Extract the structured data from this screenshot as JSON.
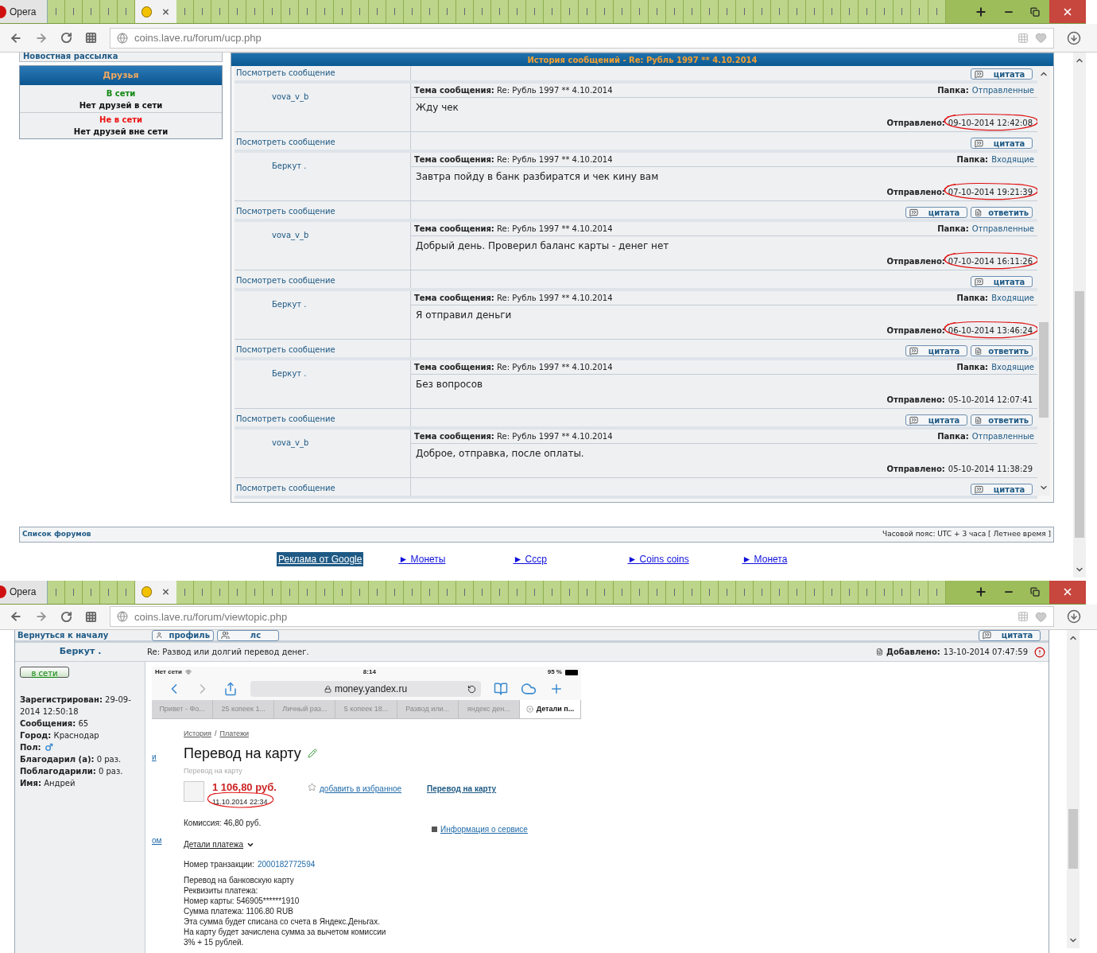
{
  "top_window": {
    "app_label": "Opera",
    "url": "coins.lave.ru/forum/ucp.php",
    "sidebar": {
      "newsletter_link": "Новостная рассылка",
      "friends_title": "Друзья",
      "groups": [
        {
          "heading": "В сети",
          "color": "#118811",
          "note": "Нет друзей в сети"
        },
        {
          "heading": "Не в сети",
          "color": "#ee1111",
          "note": "Нет друзей вне сети"
        }
      ]
    },
    "panel_title": "История сообщений - Re: Рубль 1997 ** 4.10.2014",
    "partial_row": {
      "view_link": "Посмотреть сообщение",
      "buttons": [
        {
          "kind": "quote",
          "label": "цитата"
        }
      ]
    },
    "messages": [
      {
        "author": "vova_v_b",
        "subject_label": "Тема сообщения:",
        "subject": "Re: Рубль 1997 ** 4.10.2014",
        "folder_label": "Папка:",
        "folder": "Отправленные",
        "body": "Жду чек",
        "sent_label": "Отправлено:",
        "sent": "09-10-2014 12:42:08",
        "circled": true,
        "view_link": "Посмотреть сообщение",
        "buttons": [
          {
            "kind": "quote",
            "label": "цитата"
          }
        ]
      },
      {
        "author": "Беркут .",
        "subject_label": "Тема сообщения:",
        "subject": "Re: Рубль 1997 ** 4.10.2014",
        "folder_label": "Папка:",
        "folder": "Входящие",
        "body": "Завтра пойду в банк разбиратся и чек кину вам",
        "sent_label": "Отправлено:",
        "sent": "07-10-2014 19:21:39",
        "circled": true,
        "view_link": "Посмотреть сообщение",
        "buttons": [
          {
            "kind": "quote",
            "label": "цитата"
          },
          {
            "kind": "reply",
            "label": "ответить"
          }
        ]
      },
      {
        "author": "vova_v_b",
        "subject_label": "Тема сообщения:",
        "subject": "Re: Рубль 1997 ** 4.10.2014",
        "folder_label": "Папка:",
        "folder": "Отправленные",
        "body": "Добрый день. Проверил баланс карты - денег нет",
        "sent_label": "Отправлено:",
        "sent": "07-10-2014 16:11:26",
        "circled": true,
        "view_link": "Посмотреть сообщение",
        "buttons": [
          {
            "kind": "quote",
            "label": "цитата"
          }
        ]
      },
      {
        "author": "Беркут .",
        "subject_label": "Тема сообщения:",
        "subject": "Re: Рубль 1997 ** 4.10.2014",
        "folder_label": "Папка:",
        "folder": "Входящие",
        "body": "Я отправил деньги",
        "sent_label": "Отправлено:",
        "sent": "06-10-2014 13:46:24",
        "circled": true,
        "view_link": "Посмотреть сообщение",
        "buttons": [
          {
            "kind": "quote",
            "label": "цитата"
          },
          {
            "kind": "reply",
            "label": "ответить"
          }
        ]
      },
      {
        "author": "Беркут .",
        "subject_label": "Тема сообщения:",
        "subject": "Re: Рубль 1997 ** 4.10.2014",
        "folder_label": "Папка:",
        "folder": "Входящие",
        "body": "Без вопросов",
        "sent_label": "Отправлено:",
        "sent": "05-10-2014 12:07:41",
        "circled": false,
        "view_link": "Посмотреть сообщение",
        "buttons": [
          {
            "kind": "quote",
            "label": "цитата"
          },
          {
            "kind": "reply",
            "label": "ответить"
          }
        ]
      },
      {
        "author": "vova_v_b",
        "subject_label": "Тема сообщения:",
        "subject": "Re: Рубль 1997 ** 4.10.2014",
        "folder_label": "Папка:",
        "folder": "Отправленные",
        "body": "Доброе, отправка, после оплаты.",
        "sent_label": "Отправлено:",
        "sent": "05-10-2014 11:38:29",
        "circled": false,
        "view_link": "Посмотреть сообщение",
        "buttons": [
          {
            "kind": "quote",
            "label": "цитата"
          }
        ]
      }
    ],
    "footer": {
      "forums_link": "Список форумов",
      "timezone": "Часовой пояс: UTC + 3 часа [ Летнее время ]"
    },
    "ads": {
      "label": "Реклама от Google",
      "links": [
        "► Монеты",
        "► Ссср",
        "► Coins coins",
        "► Монета"
      ]
    }
  },
  "bottom_window": {
    "app_label": "Opera",
    "url": "coins.lave.ru/forum/viewtopic.php",
    "toolbar": {
      "back_link": "Вернуться к началу",
      "buttons": [
        {
          "kind": "profile",
          "label": "профиль"
        },
        {
          "kind": "pm",
          "label": "лс"
        }
      ],
      "quote_button": "цитата"
    },
    "post": {
      "author": "Беркут .",
      "title": "Re: Развод или долгий перевод денег.",
      "added_label": "Добавлено:",
      "added": "13-10-2014 07:47:59"
    },
    "profile": {
      "status_button": "в сети",
      "fields": [
        {
          "kind": "text",
          "text": "**Зарегистрирован:** 29-09-2014 12:50:18"
        },
        {
          "kind": "text",
          "text": "**Сообщения:** 65"
        },
        {
          "kind": "text",
          "text": "**Город:** Краснодар"
        },
        {
          "kind": "gender",
          "text": "**Пол:**"
        },
        {
          "kind": "text",
          "text": "**Благодарил (а):** 0 раз."
        },
        {
          "kind": "text",
          "text": "**Поблагодарили:** 0 раз."
        },
        {
          "kind": "text",
          "text": "**Имя:** Андрей"
        }
      ]
    },
    "screenshot": {
      "carrier": "Нет сети",
      "time": "8:14",
      "battery": "95 %",
      "url": "money.yandex.ru",
      "tabs": [
        {
          "label": "Привет - Фо...",
          "selected": false
        },
        {
          "label": "25 копеек 1...",
          "selected": false
        },
        {
          "label": "Личный раз...",
          "selected": false
        },
        {
          "label": "5 копеек 18...",
          "selected": false
        },
        {
          "label": "Развод или...",
          "selected": false
        },
        {
          "label": "яндекс ден...",
          "selected": false
        },
        {
          "label": "Детали п...",
          "selected": true
        }
      ],
      "breadcrumb": [
        "История",
        "Платежи"
      ],
      "breadcrumb_separator": "/",
      "heading": "Перевод на карту",
      "subtitle": "Перевод на карту",
      "amount": "1 106,80 руб.",
      "date": "11.10.2014 22:34",
      "circled": true,
      "favorite_link": "добавить в избранное",
      "type_link": "Перевод на карту",
      "commission": "Комиссия: 46,80 руб.",
      "info_link": "Информация о сервисе",
      "details_toggle": "Детали платежа",
      "transaction_label": "Номер транзакции:",
      "transaction_id": "2000182772594",
      "details_lines": [
        "Перевод на банковскую карту",
        "Реквизиты платежа:",
        "Номер карты: 546905******1910",
        "Сумма платежа: 1106.80 RUB",
        "Эта сумма будет списана со счета в Яндекс.Деньгах.",
        "На карту будет зачислена сумма за вычетом комиссии",
        "3% + 15 рублей."
      ],
      "edge_fragments": [
        "и",
        "ом"
      ]
    }
  }
}
